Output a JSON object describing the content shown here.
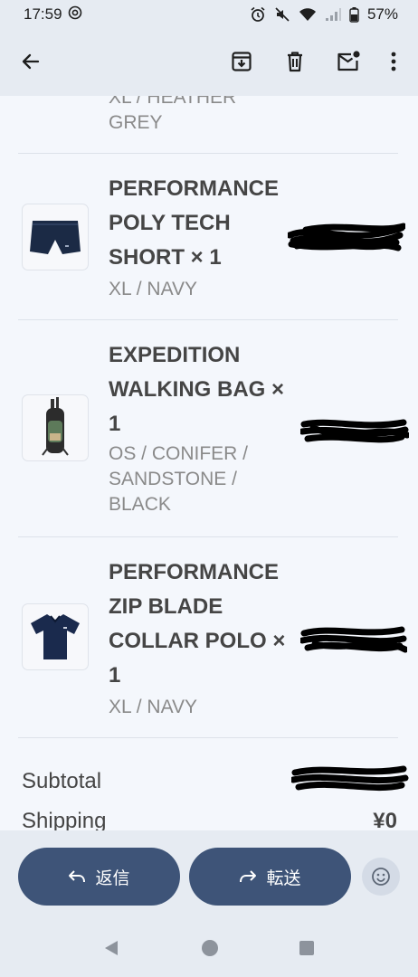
{
  "status_bar": {
    "time": "17:59",
    "battery": "57%"
  },
  "app_bar": {
    "back_icon": "arrow-left-icon",
    "archive_icon": "archive-icon",
    "delete_icon": "trash-icon",
    "mark_unread_icon": "mail-unread-icon",
    "more_icon": "more-vert-icon"
  },
  "order": {
    "items": [
      {
        "name": "",
        "variant": "XL / HEATHER\nGREY",
        "thumbnail": ""
      },
      {
        "name": "PERFORMANCE POLY TECH SHORT × 1",
        "variant": "XL / NAVY",
        "thumbnail": "navy-shorts"
      },
      {
        "name": "EXPEDITION WALKING BAG × 1",
        "variant": "OS / CONIFER / SANDSTONE / BLACK",
        "thumbnail": "golf-bag"
      },
      {
        "name": "PERFORMANCE ZIP BLADE COLLAR POLO × 1",
        "variant": "XL / NAVY",
        "thumbnail": "navy-polo"
      }
    ],
    "summary": {
      "subtotal_label": "Subtotal",
      "shipping_label": "Shipping",
      "shipping_value": "¥0"
    }
  },
  "actions": {
    "reply_label": "返信",
    "forward_label": "転送",
    "reply_icon": "reply-icon",
    "forward_icon": "forward-icon",
    "emoji_icon": "emoji-icon"
  },
  "colors": {
    "pill": "#3e5478",
    "bar": "#e6ebf2",
    "background": "#f4f7fc"
  }
}
